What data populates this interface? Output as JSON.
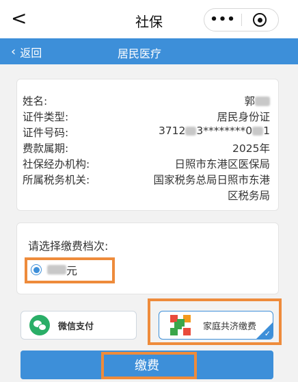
{
  "app": {
    "title": "社保",
    "back_glyph": "<",
    "more_glyph": "•••",
    "target_icon": "target-icon"
  },
  "subheader": {
    "back_label": "返回",
    "title": "居民医疗",
    "background": "#3d8fd9"
  },
  "info": {
    "rows": [
      {
        "label": "姓名:",
        "value_prefix": "郭",
        "value_suffix": ""
      },
      {
        "label": "证件类型:",
        "value": "居民身份证"
      },
      {
        "label": "证件号码:",
        "value_prefix": "3712",
        "value_middle": "3********0",
        "value_suffix": "1"
      },
      {
        "label": "费款属期:",
        "value": "2025年"
      },
      {
        "label": "社保经办机构:",
        "value": "日照市东港区医保局"
      },
      {
        "label": "所属税务机关:",
        "value": "国家税务总局日照市东港",
        "value_line2": "区税务局"
      }
    ]
  },
  "grade": {
    "prompt": "请选择缴费档次:",
    "option_suffix": "元",
    "selected": true
  },
  "payment_methods": {
    "wechat_label": "微信支付",
    "family_label": "家庭共济缴费",
    "selected": "family"
  },
  "actions": {
    "pay_label": "缴费"
  },
  "colors": {
    "accent": "#3d8fd9",
    "highlight": "#ee8b3b",
    "wechat": "#2aae67"
  }
}
